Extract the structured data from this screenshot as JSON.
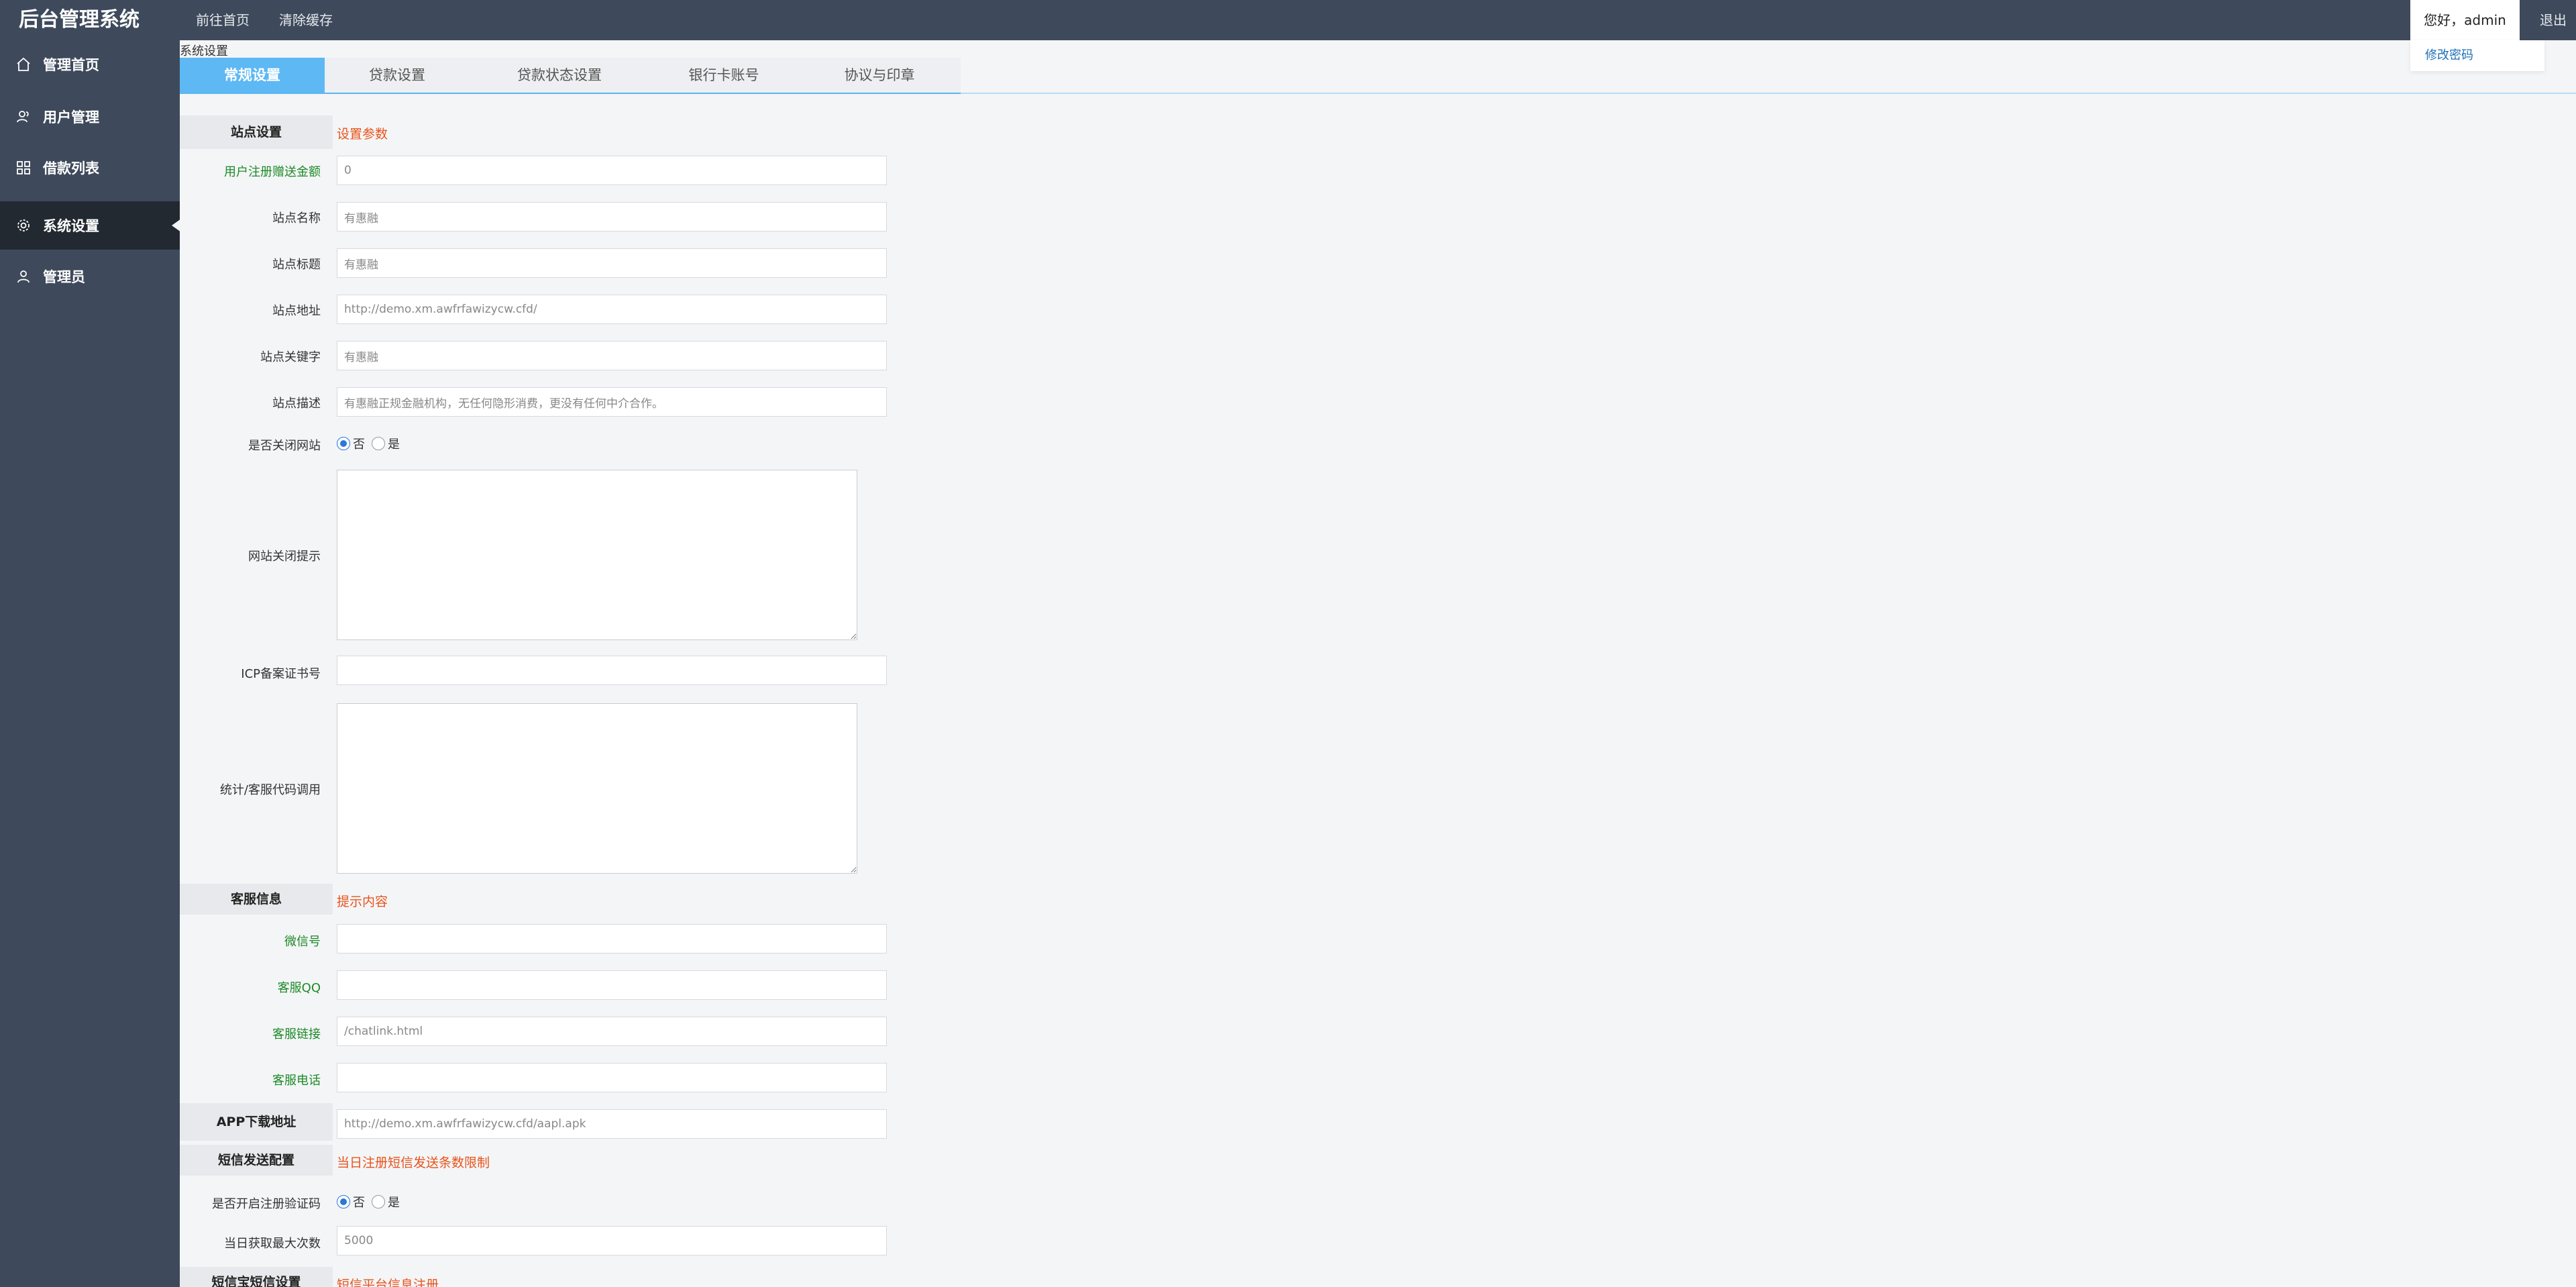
{
  "header": {
    "logo": "后台管理系统",
    "nav": [
      "前往首页",
      "清除缓存"
    ],
    "greeting": "您好，admin",
    "change_password": "修改密码",
    "logout": "退出"
  },
  "sidebar": {
    "items": [
      {
        "label": "管理首页",
        "icon": "home-icon"
      },
      {
        "label": "用户管理",
        "icon": "users-icon"
      },
      {
        "label": "借款列表",
        "icon": "grid-icon"
      },
      {
        "label": "系统设置",
        "icon": "gear-icon",
        "active": true
      },
      {
        "label": "管理员",
        "icon": "user-icon"
      }
    ]
  },
  "breadcrumb": "系统设置",
  "tabs": [
    "常规设置",
    "贷款设置",
    "贷款状态设置",
    "银行卡账号",
    "协议与印章"
  ],
  "form": {
    "site_section": {
      "title": "站点设置",
      "note": "设置参数"
    },
    "register_bonus": {
      "label": "用户注册赠送金额",
      "value": "0"
    },
    "site_name": {
      "label": "站点名称",
      "value": "有惠融"
    },
    "site_title": {
      "label": "站点标题",
      "value": "有惠融"
    },
    "site_url": {
      "label": "站点地址",
      "value": "http://demo.xm.awfrfawizycw.cfd/"
    },
    "site_keywords": {
      "label": "站点关键字",
      "value": "有惠融"
    },
    "site_desc": {
      "label": "站点描述",
      "value": "有惠融正规金融机构，无任何隐形消费，更没有任何中介合作。"
    },
    "close_site": {
      "label": "是否关闭网站",
      "no": "否",
      "yes": "是"
    },
    "close_tip": {
      "label": "网站关闭提示"
    },
    "icp": {
      "label": "ICP备案证书号",
      "value": ""
    },
    "stats_code": {
      "label": "统计/客服代码调用"
    },
    "service_section": {
      "title": "客服信息",
      "note": "提示内容"
    },
    "wechat": {
      "label": "微信号",
      "value": ""
    },
    "qq": {
      "label": "客服QQ",
      "value": ""
    },
    "chat_link": {
      "label": "客服链接",
      "value": "/chatlink.html"
    },
    "phone": {
      "label": "客服电话",
      "value": ""
    },
    "app_download": {
      "label": "APP下载地址",
      "value": "http://demo.xm.awfrfawizycw.cfd/aapl.apk"
    },
    "sms_section": {
      "title": "短信发送配置",
      "note": "当日注册短信发送条数限制"
    },
    "register_code": {
      "label": "是否开启注册验证码",
      "no": "否",
      "yes": "是"
    },
    "daily_max": {
      "label": "当日获取最大次数",
      "value": "5000"
    },
    "sms_platform_section": {
      "title": "短信宝短信设置",
      "note": "短信平台信息注册"
    }
  }
}
